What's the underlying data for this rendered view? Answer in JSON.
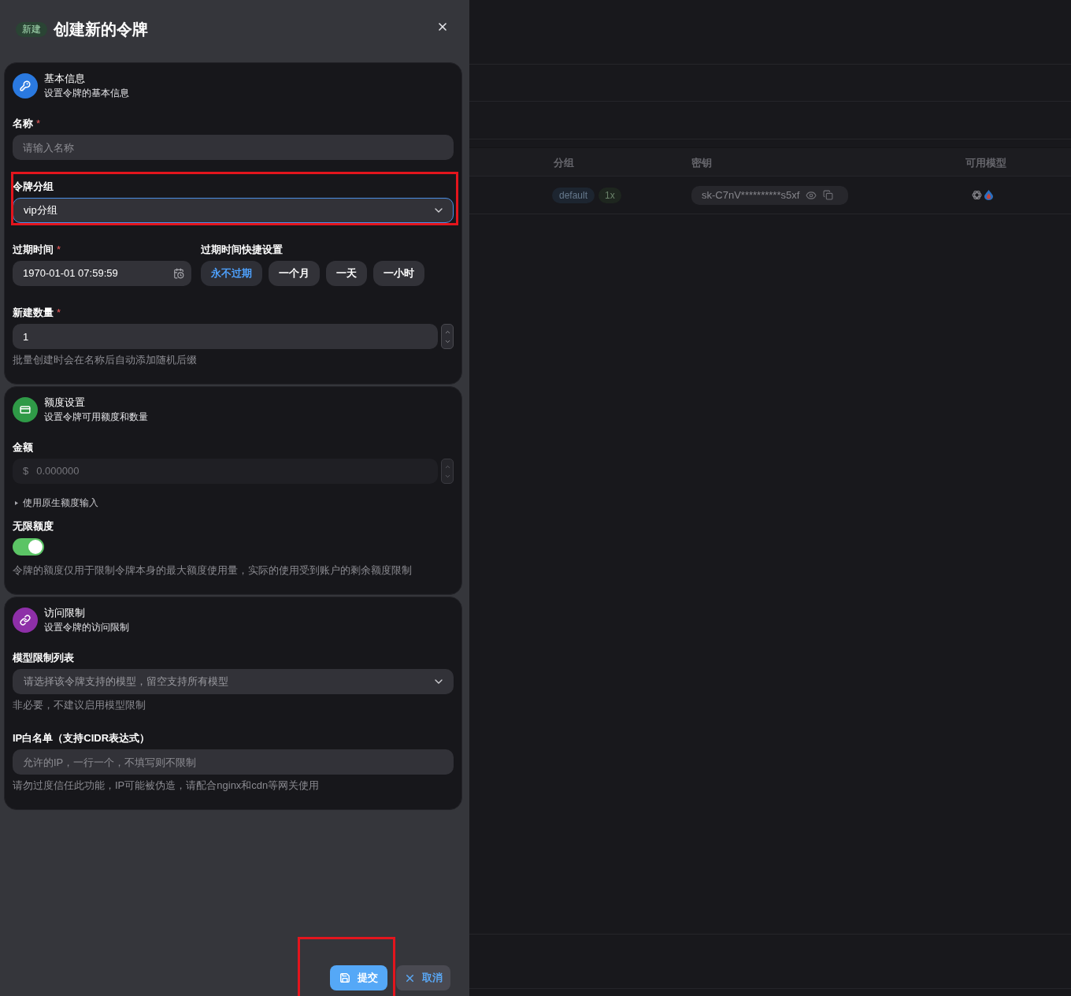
{
  "drawer": {
    "badge": "新建",
    "title": "创建新的令牌",
    "sections": [
      {
        "title": "基本信息",
        "subtitle": "设置令牌的基本信息",
        "color": "#2a79e0",
        "fields": [
          {
            "kind": "input",
            "label": "名称",
            "mark": "*",
            "placeholder": "请输入名称"
          },
          {
            "kind": "select",
            "label": "令牌分组",
            "value": "vip分组",
            "focused": true,
            "highlighted": true
          },
          {
            "kind": "expiry",
            "label": "过期时间",
            "mark": "*",
            "value": "1970-01-01 07:59:59",
            "quick_label": "过期时间快捷设置",
            "quick_options": [
              {
                "label": "永不过期",
                "selected": true
              },
              {
                "label": "一个月",
                "selected": false
              },
              {
                "label": "一天",
                "selected": false
              },
              {
                "label": "一小时",
                "selected": false
              }
            ]
          },
          {
            "kind": "number",
            "label": "新建数量",
            "mark": "*",
            "value": "1",
            "help": "批量创建时会在名称后自动添加随机后缀"
          }
        ]
      },
      {
        "title": "额度设置",
        "subtitle": "设置令牌可用额度和数量",
        "color": "#2f9a47",
        "fields": [
          {
            "kind": "amount",
            "label": "金额",
            "prefix": "$",
            "value": "0.000000",
            "disabled": true
          },
          {
            "kind": "disclosure",
            "label": "使用原生额度输入",
            "expanded": false
          },
          {
            "kind": "switch",
            "label": "无限额度",
            "on": true,
            "help": "令牌的额度仅用于限制令牌本身的最大额度使用量，实际的使用受到账户的剩余额度限制"
          }
        ]
      },
      {
        "title": "访问限制",
        "subtitle": "设置令牌的访问限制",
        "color": "#8e2fa8",
        "fields": [
          {
            "kind": "select",
            "label": "模型限制列表",
            "placeholder": "请选择该令牌支持的模型，留空支持所有模型",
            "focused": false,
            "help": "非必要，不建议启用模型限制"
          },
          {
            "kind": "input",
            "label": "IP白名单（支持CIDR表达式）",
            "placeholder": "允许的IP，一行一个，不填写则不限制",
            "help": "请勿过度信任此功能，IP可能被伪造，请配合nginx和cdn等网关使用"
          }
        ]
      }
    ],
    "buttons": [
      {
        "kind": "submit",
        "label": "提交",
        "highlighted": true
      },
      {
        "kind": "cancel",
        "label": "取消"
      }
    ]
  },
  "background_table": {
    "columns": [
      "分组",
      "密钥",
      "可用模型"
    ],
    "rows": [
      {
        "group": "default",
        "ratio": "1x",
        "key": "sk-C7nV**********s5xf"
      }
    ]
  }
}
